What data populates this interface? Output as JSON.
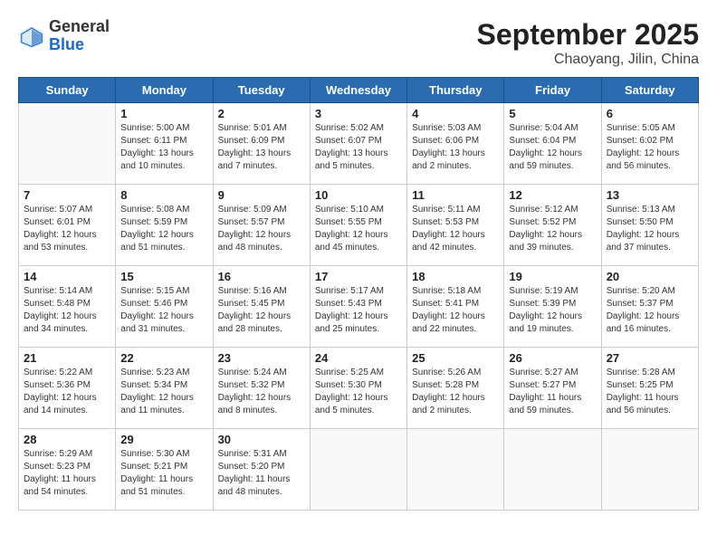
{
  "header": {
    "logo_general": "General",
    "logo_blue": "Blue",
    "month_title": "September 2025",
    "location": "Chaoyang, Jilin, China"
  },
  "days_of_week": [
    "Sunday",
    "Monday",
    "Tuesday",
    "Wednesday",
    "Thursday",
    "Friday",
    "Saturday"
  ],
  "weeks": [
    [
      {
        "day": "",
        "info": ""
      },
      {
        "day": "1",
        "info": "Sunrise: 5:00 AM\nSunset: 6:11 PM\nDaylight: 13 hours\nand 10 minutes."
      },
      {
        "day": "2",
        "info": "Sunrise: 5:01 AM\nSunset: 6:09 PM\nDaylight: 13 hours\nand 7 minutes."
      },
      {
        "day": "3",
        "info": "Sunrise: 5:02 AM\nSunset: 6:07 PM\nDaylight: 13 hours\nand 5 minutes."
      },
      {
        "day": "4",
        "info": "Sunrise: 5:03 AM\nSunset: 6:06 PM\nDaylight: 13 hours\nand 2 minutes."
      },
      {
        "day": "5",
        "info": "Sunrise: 5:04 AM\nSunset: 6:04 PM\nDaylight: 12 hours\nand 59 minutes."
      },
      {
        "day": "6",
        "info": "Sunrise: 5:05 AM\nSunset: 6:02 PM\nDaylight: 12 hours\nand 56 minutes."
      }
    ],
    [
      {
        "day": "7",
        "info": "Sunrise: 5:07 AM\nSunset: 6:01 PM\nDaylight: 12 hours\nand 53 minutes."
      },
      {
        "day": "8",
        "info": "Sunrise: 5:08 AM\nSunset: 5:59 PM\nDaylight: 12 hours\nand 51 minutes."
      },
      {
        "day": "9",
        "info": "Sunrise: 5:09 AM\nSunset: 5:57 PM\nDaylight: 12 hours\nand 48 minutes."
      },
      {
        "day": "10",
        "info": "Sunrise: 5:10 AM\nSunset: 5:55 PM\nDaylight: 12 hours\nand 45 minutes."
      },
      {
        "day": "11",
        "info": "Sunrise: 5:11 AM\nSunset: 5:53 PM\nDaylight: 12 hours\nand 42 minutes."
      },
      {
        "day": "12",
        "info": "Sunrise: 5:12 AM\nSunset: 5:52 PM\nDaylight: 12 hours\nand 39 minutes."
      },
      {
        "day": "13",
        "info": "Sunrise: 5:13 AM\nSunset: 5:50 PM\nDaylight: 12 hours\nand 37 minutes."
      }
    ],
    [
      {
        "day": "14",
        "info": "Sunrise: 5:14 AM\nSunset: 5:48 PM\nDaylight: 12 hours\nand 34 minutes."
      },
      {
        "day": "15",
        "info": "Sunrise: 5:15 AM\nSunset: 5:46 PM\nDaylight: 12 hours\nand 31 minutes."
      },
      {
        "day": "16",
        "info": "Sunrise: 5:16 AM\nSunset: 5:45 PM\nDaylight: 12 hours\nand 28 minutes."
      },
      {
        "day": "17",
        "info": "Sunrise: 5:17 AM\nSunset: 5:43 PM\nDaylight: 12 hours\nand 25 minutes."
      },
      {
        "day": "18",
        "info": "Sunrise: 5:18 AM\nSunset: 5:41 PM\nDaylight: 12 hours\nand 22 minutes."
      },
      {
        "day": "19",
        "info": "Sunrise: 5:19 AM\nSunset: 5:39 PM\nDaylight: 12 hours\nand 19 minutes."
      },
      {
        "day": "20",
        "info": "Sunrise: 5:20 AM\nSunset: 5:37 PM\nDaylight: 12 hours\nand 16 minutes."
      }
    ],
    [
      {
        "day": "21",
        "info": "Sunrise: 5:22 AM\nSunset: 5:36 PM\nDaylight: 12 hours\nand 14 minutes."
      },
      {
        "day": "22",
        "info": "Sunrise: 5:23 AM\nSunset: 5:34 PM\nDaylight: 12 hours\nand 11 minutes."
      },
      {
        "day": "23",
        "info": "Sunrise: 5:24 AM\nSunset: 5:32 PM\nDaylight: 12 hours\nand 8 minutes."
      },
      {
        "day": "24",
        "info": "Sunrise: 5:25 AM\nSunset: 5:30 PM\nDaylight: 12 hours\nand 5 minutes."
      },
      {
        "day": "25",
        "info": "Sunrise: 5:26 AM\nSunset: 5:28 PM\nDaylight: 12 hours\nand 2 minutes."
      },
      {
        "day": "26",
        "info": "Sunrise: 5:27 AM\nSunset: 5:27 PM\nDaylight: 11 hours\nand 59 minutes."
      },
      {
        "day": "27",
        "info": "Sunrise: 5:28 AM\nSunset: 5:25 PM\nDaylight: 11 hours\nand 56 minutes."
      }
    ],
    [
      {
        "day": "28",
        "info": "Sunrise: 5:29 AM\nSunset: 5:23 PM\nDaylight: 11 hours\nand 54 minutes."
      },
      {
        "day": "29",
        "info": "Sunrise: 5:30 AM\nSunset: 5:21 PM\nDaylight: 11 hours\nand 51 minutes."
      },
      {
        "day": "30",
        "info": "Sunrise: 5:31 AM\nSunset: 5:20 PM\nDaylight: 11 hours\nand 48 minutes."
      },
      {
        "day": "",
        "info": ""
      },
      {
        "day": "",
        "info": ""
      },
      {
        "day": "",
        "info": ""
      },
      {
        "day": "",
        "info": ""
      }
    ]
  ]
}
